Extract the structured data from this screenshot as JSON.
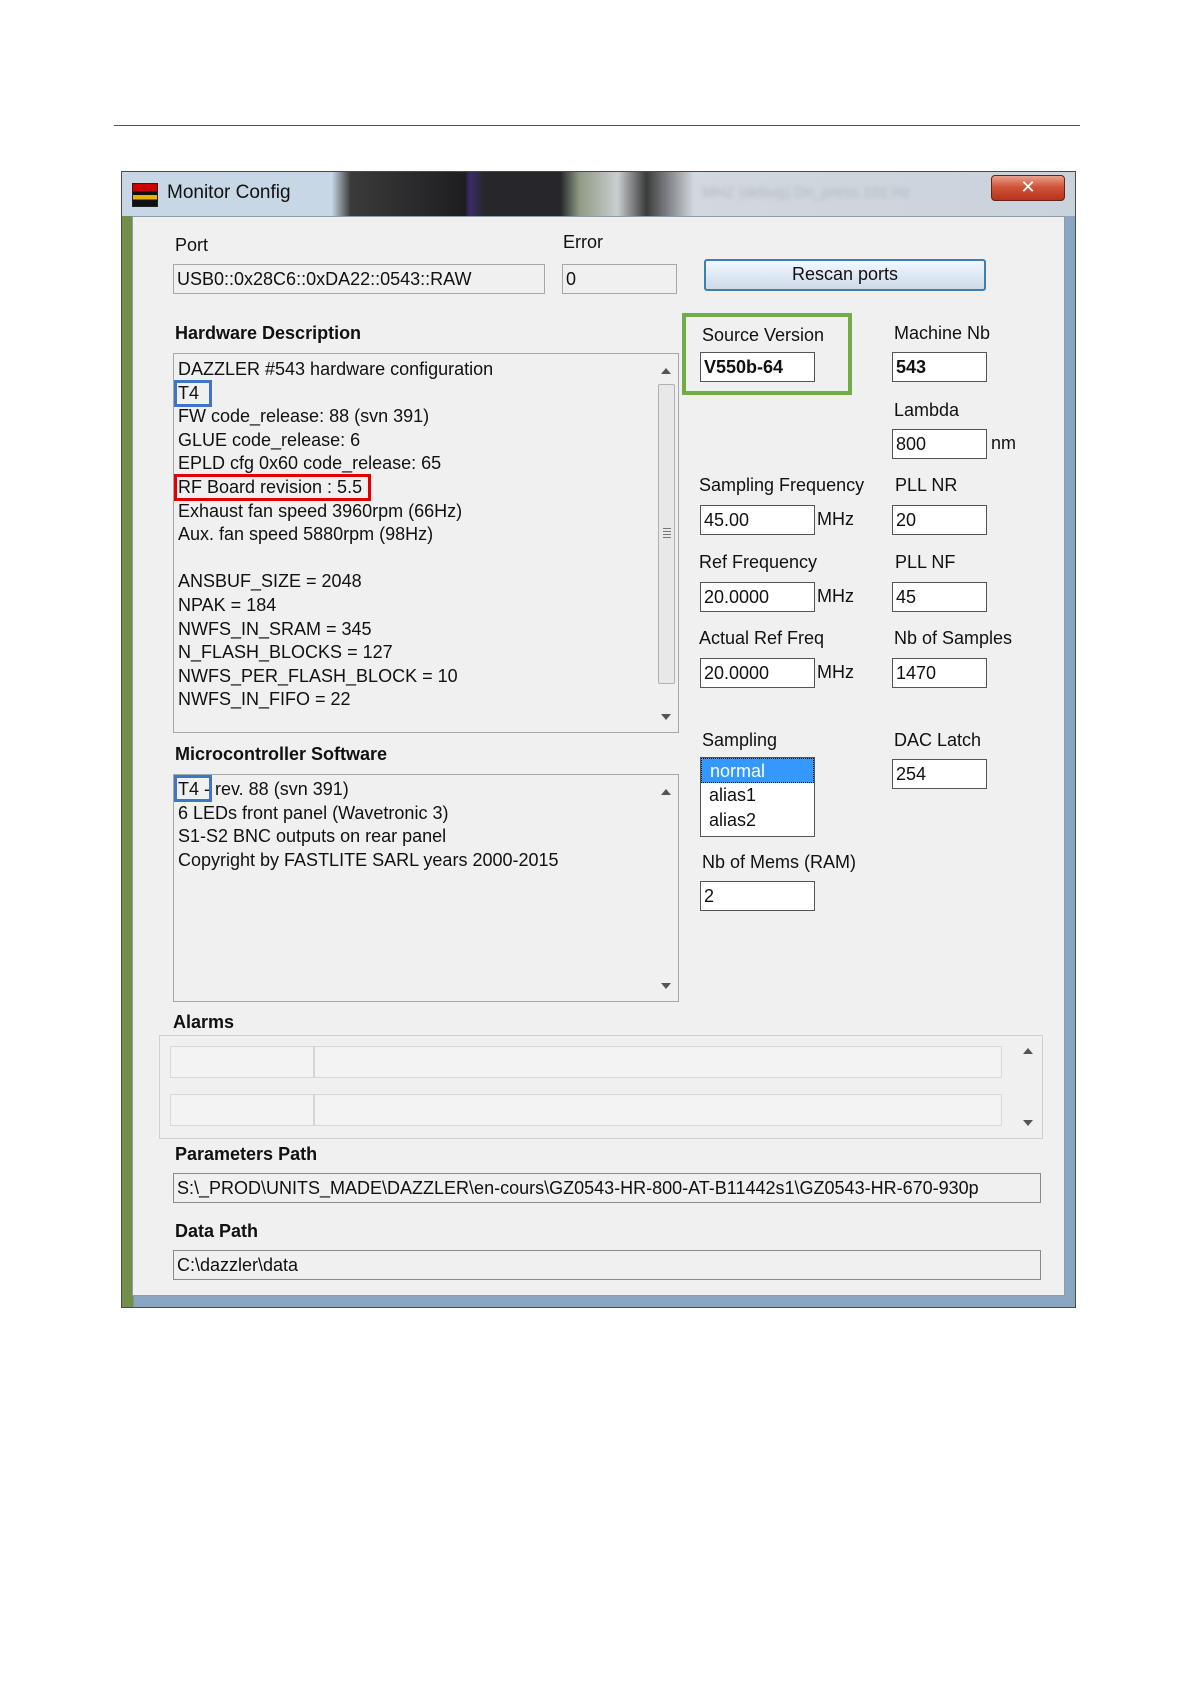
{
  "window": {
    "title": "Monitor Config",
    "blurred_title": "MHZ (debug) Dn_press 101 Hz",
    "close_glyph": "✕"
  },
  "port": {
    "label": "Port",
    "value": "USB0::0x28C6::0xDA22::0543::RAW"
  },
  "error": {
    "label": "Error",
    "value": "0"
  },
  "rescan_button": "Rescan ports",
  "hardware": {
    "label": "Hardware Description",
    "lines": [
      "DAZZLER #543 hardware configuration",
      "T4",
      "FW code_release: 88 (svn 391)",
      "GLUE code_release: 6",
      "EPLD cfg 0x60 code_release: 65",
      "RF Board revision : 5.5",
      "Exhaust fan speed 3960rpm (66Hz)",
      "Aux. fan speed 5880rpm (98Hz)",
      "",
      "ANSBUF_SIZE = 2048",
      "NPAK = 184",
      "NWFS_IN_SRAM = 345",
      "N_FLASH_BLOCKS = 127",
      "NWFS_PER_FLASH_BLOCK = 10",
      "NWFS_IN_FIFO = 22"
    ]
  },
  "microcontroller": {
    "label": "Microcontroller Software",
    "lines": [
      "T4 - rev. 88 (svn 391)",
      "6 LEDs front panel (Wavetronic 3)",
      "S1-S2 BNC outputs on rear panel",
      "Copyright by FASTLITE SARL years 2000-2015"
    ]
  },
  "source_version": {
    "label": "Source Version",
    "value": "V550b-64"
  },
  "machine_nb": {
    "label": "Machine Nb",
    "value": "543"
  },
  "lambda": {
    "label": "Lambda",
    "value": "800",
    "unit": "nm"
  },
  "sampling_frequency": {
    "label": "Sampling Frequency",
    "value": "45.00",
    "unit": "MHz"
  },
  "pll_nr": {
    "label": "PLL NR",
    "value": "20"
  },
  "ref_frequency": {
    "label": "Ref Frequency",
    "value": "20.0000",
    "unit": "MHz"
  },
  "pll_nf": {
    "label": "PLL NF",
    "value": "45"
  },
  "actual_ref_freq": {
    "label": "Actual Ref Freq",
    "value": "20.0000",
    "unit": "MHz"
  },
  "nb_samples": {
    "label": "Nb of Samples",
    "value": "1470"
  },
  "sampling": {
    "label": "Sampling",
    "options": [
      "normal",
      "alias1",
      "alias2"
    ],
    "selected": "normal"
  },
  "dac_latch": {
    "label": "DAC Latch",
    "value": "254"
  },
  "nb_mems": {
    "label": "Nb of Mems (RAM)",
    "value": "2"
  },
  "alarms": {
    "label": "Alarms"
  },
  "parameters_path": {
    "label": "Parameters Path",
    "value": "S:\\_PROD\\UNITS_MADE\\DAZZLER\\en-cours\\GZ0543-HR-800-AT-B11442s1\\GZ0543-HR-670-930p"
  },
  "data_path": {
    "label": "Data Path",
    "value": "C:\\dazzler\\data"
  },
  "colors": {
    "highlight_blue": "#4472c4",
    "highlight_red": "#e00000",
    "highlight_green": "#70ad47",
    "selection": "#3399ff",
    "button_border": "#3c7fb1"
  }
}
